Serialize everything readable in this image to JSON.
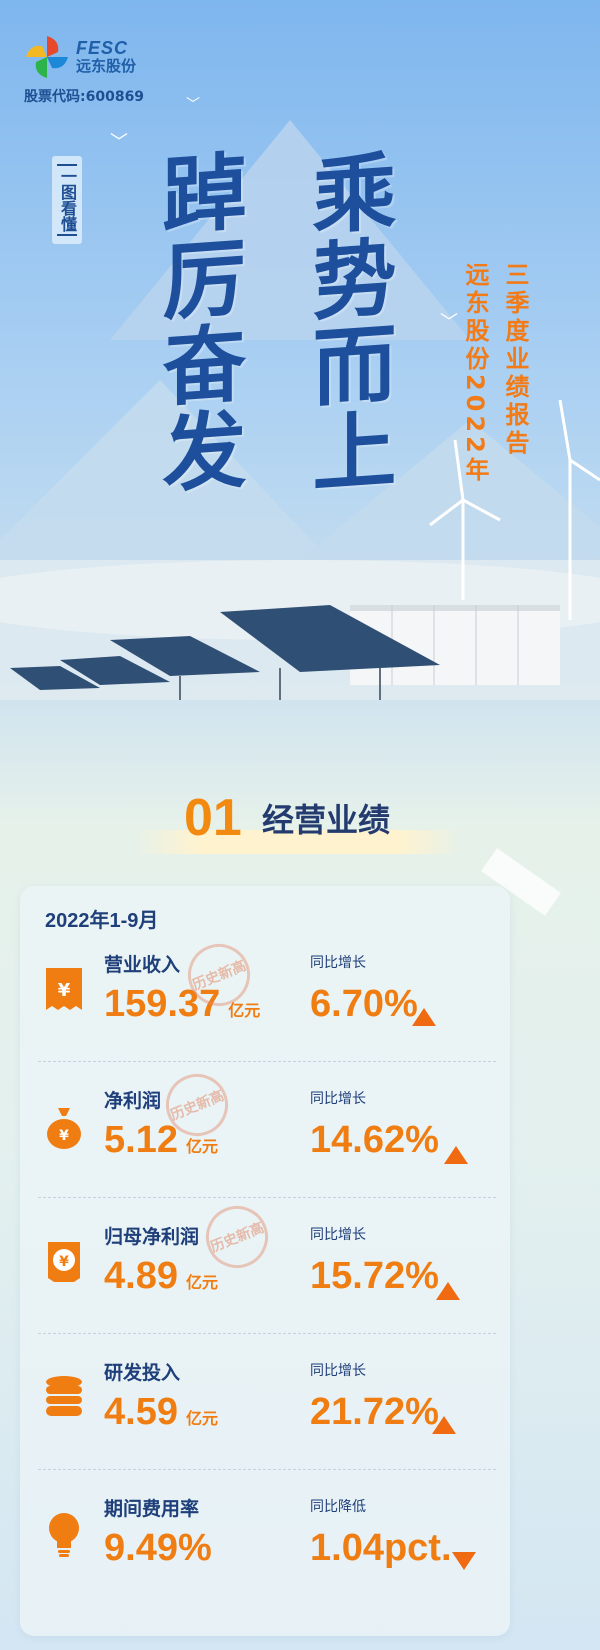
{
  "company": {
    "logo_en": "FESC",
    "logo_cn": "远东股份",
    "stock_code": "股票代码:600869"
  },
  "hero": {
    "tag": "一图看懂",
    "slogan_left": "踔厉奋发",
    "slogan_right": "乘势而上",
    "report_right": "三季度业绩报告",
    "report_left": "远东股份2022年"
  },
  "section": {
    "number": "01",
    "title": "经营业绩"
  },
  "period": "2022年1-9月",
  "stamp_text": "历史新高",
  "metrics": [
    {
      "label": "营业收入",
      "value": "159.37",
      "unit": "亿元",
      "yoy_label": "同比增长",
      "yoy": "6.70%",
      "direction": "up",
      "stamp": true,
      "icon": "receipt-yuan-icon"
    },
    {
      "label": "净利润",
      "value": "5.12",
      "unit": "亿元",
      "yoy_label": "同比增长",
      "yoy": "14.62%",
      "direction": "up",
      "stamp": true,
      "icon": "money-bag-icon"
    },
    {
      "label": "归母净利润",
      "value": "4.89",
      "unit": "亿元",
      "yoy_label": "同比增长",
      "yoy": "15.72%",
      "direction": "up",
      "stamp": true,
      "icon": "yuan-card-icon"
    },
    {
      "label": "研发投入",
      "value": "4.59",
      "unit": "亿元",
      "yoy_label": "同比增长",
      "yoy": "21.72%",
      "direction": "up",
      "stamp": false,
      "icon": "coin-stack-icon"
    },
    {
      "label": "期间费用率",
      "value": "9.49%",
      "unit": "",
      "yoy_label": "同比降低",
      "yoy": "1.04pct.",
      "direction": "down",
      "stamp": false,
      "icon": "lightbulb-icon"
    }
  ],
  "colors": {
    "accent": "#f07d12",
    "navy": "#1f3f7a",
    "calligraphy": "#1d4f9c"
  }
}
